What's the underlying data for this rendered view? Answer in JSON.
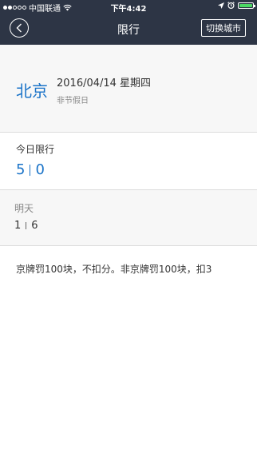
{
  "status_bar": {
    "carrier": "中国联通",
    "time": "下午4:42",
    "signal_filled": 2,
    "signal_total": 5
  },
  "nav": {
    "title": "限行",
    "switch_city_label": "切换城市",
    "back_icon": "chevron-left-icon"
  },
  "city": {
    "name": "北京",
    "date": "2016/04/14 星期四",
    "holiday_status": "非节假日"
  },
  "today": {
    "label": "今日限行",
    "plate_1": "5",
    "plate_2": "0"
  },
  "tomorrow": {
    "label": "明天",
    "plate_1": "1",
    "plate_2": "6"
  },
  "rule": {
    "text": "京牌罚100块，不扣分。非京牌罚100块，扣3"
  },
  "colors": {
    "navbar": "#2d3545",
    "accent_blue": "#1a73c8",
    "battery_green": "#4cd964"
  }
}
